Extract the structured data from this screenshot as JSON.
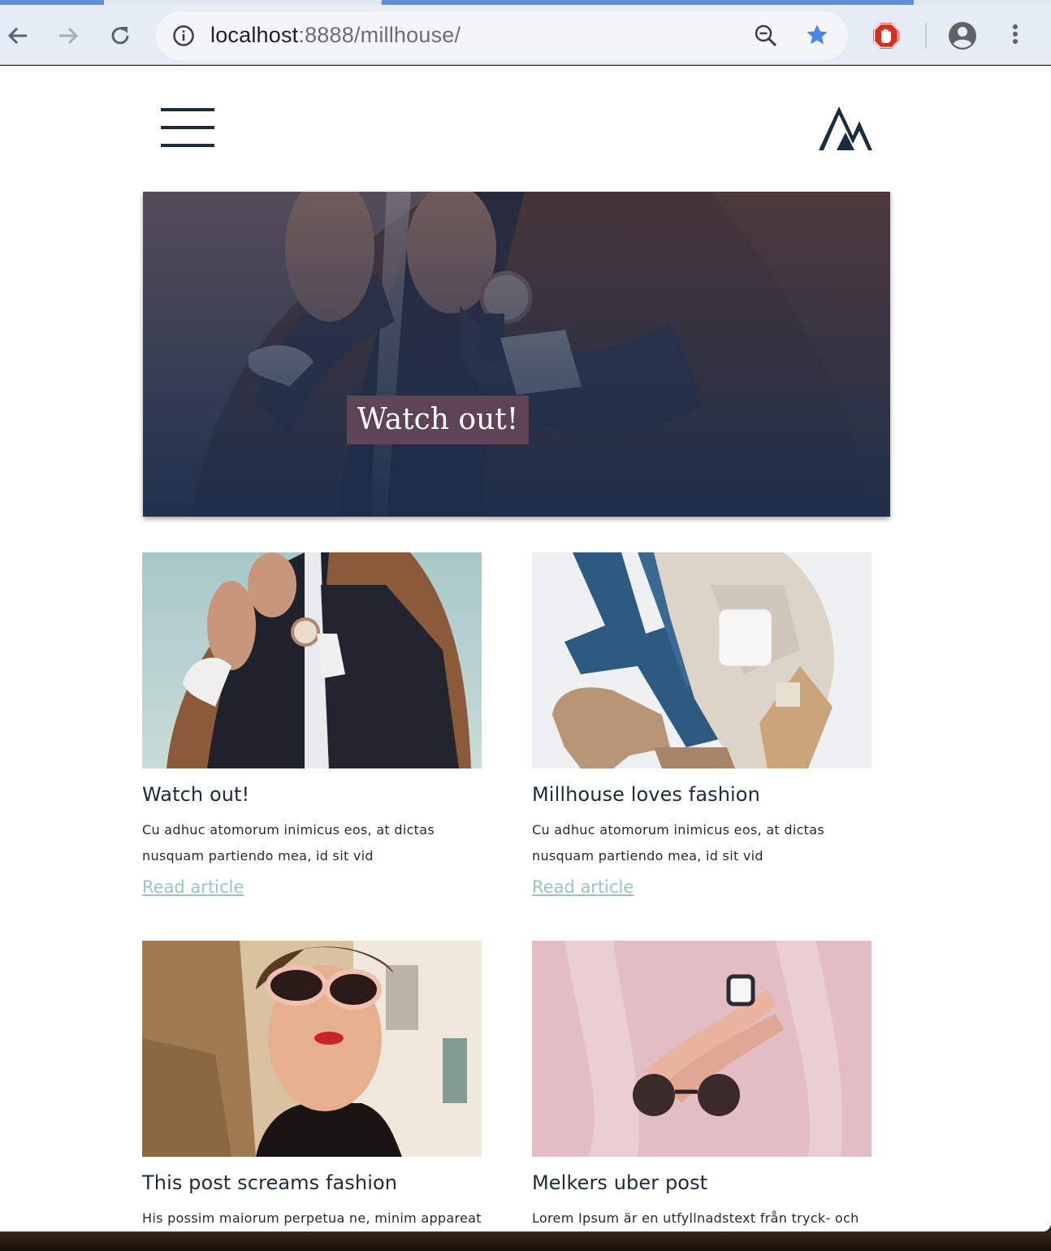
{
  "browser": {
    "url_host": "localhost",
    "url_path": ":8888/millhouse/",
    "icons": [
      "back-arrow-icon",
      "forward-arrow-icon",
      "reload-icon",
      "info-icon",
      "zoom-out-icon",
      "bookmark-star-icon",
      "adblock-icon",
      "account-icon",
      "kebab-menu-icon"
    ]
  },
  "site": {
    "logo": "M",
    "hero": {
      "label": "Watch out!"
    }
  },
  "posts": [
    {
      "title": "Watch out!",
      "excerpt": "Cu adhuc atomorum inimicus eos, at dictas nusquam partiendo mea, id sit vid",
      "link": "Read article"
    },
    {
      "title": "Millhouse loves fashion",
      "excerpt": "Cu adhuc atomorum inimicus eos, at dictas nusquam partiendo mea, id sit vid",
      "link": "Read article"
    },
    {
      "title": "This post screams fashion",
      "excerpt": "His possim maiorum perpetua ne, minim appareat"
    },
    {
      "title": "Melkers uber post",
      "excerpt": "Lorem Ipsum är en utfyllnadstext från tryck- och"
    }
  ],
  "colors": {
    "navy": "#1c2b3e",
    "badge": "#5e4454",
    "link": "#9cc3c3",
    "accent_blue": "#4a86e8"
  }
}
